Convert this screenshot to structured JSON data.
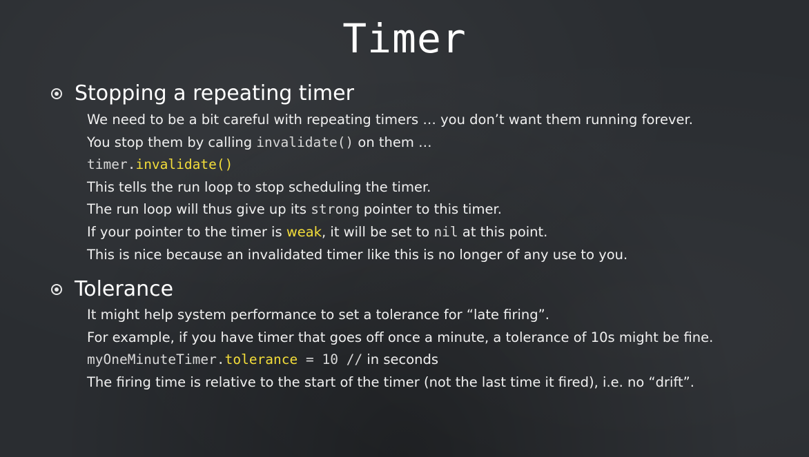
{
  "title": "Timer",
  "section1": {
    "heading": "Stopping a repeating timer",
    "line1": "We need to be a bit careful with repeating timers … you don’t want them running forever.",
    "line2_a": "You stop them by calling ",
    "line2_code": "invalidate()",
    "line2_b": " on them …",
    "line3_obj": "timer.",
    "line3_method": "invalidate()",
    "line4": "This tells the run loop to stop scheduling the timer.",
    "line5_a": "The run loop will thus give up its ",
    "line5_code": "strong",
    "line5_b": " pointer to this timer.",
    "line6_a": "If your pointer to the timer is ",
    "line6_weak": "weak",
    "line6_b": ", it will be set to ",
    "line6_code": "nil",
    "line6_c": " at this point.",
    "line7": "This is nice because an invalidated timer like this is no longer of any use to you."
  },
  "section2": {
    "heading": "Tolerance",
    "line1": "It might help system performance to set a tolerance for “late firing”.",
    "line2": "For example, if you have timer that goes off once a minute, a tolerance of 10s might be fine.",
    "line3_obj": "myOneMinuteTimer.",
    "line3_prop": "tolerance",
    "line3_val": " = 10 //",
    "line3_comment": " in seconds",
    "line4": "The firing time is relative to the start of the timer (not the last time it fired), i.e. no “drift”."
  },
  "colors": {
    "background": "#2a2d31",
    "text": "#f0f0f0",
    "highlight": "#f3dd3a"
  }
}
